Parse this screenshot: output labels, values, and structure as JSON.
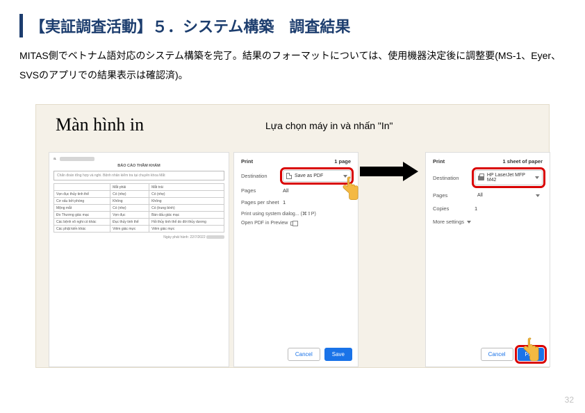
{
  "page_number": "32",
  "title": "【実証調査活動】５．システム構築　調査結果",
  "body": "MITAS側でベトナム語対応のシステム構築を完了。結果のフォーマットについては、使用機器決定後に調整要(MS-1、Eyer、SVSのアプリでの結果表示は確認済)。",
  "slide": {
    "heading": "Màn hình in",
    "sub": "Lựa chọn máy in và nhấn \"In\"",
    "doc": {
      "title": "BÁO CÁO THĂM KHÁM",
      "name_prefix": "a.",
      "box": "Chẩn đoán tổng hợp và nghi. Bệnh nhân kiểm tra tại chuyên khoa Mắt",
      "cols": [
        "",
        "Mắt phải",
        "Mắt trái"
      ],
      "rows": [
        [
          "Vẹn đục thủy tinh thể",
          "Có (nhẹ)",
          "Có (nhẹ)"
        ],
        [
          "Cơ xấu bởi phòng",
          "Không",
          "Không"
        ],
        [
          "Mộng mắt",
          "Có (nhẹ)",
          "Có (trung bình)"
        ],
        [
          "Đo Thương giác mạc",
          "Vẹn đục",
          "Bán dấu giác mạc"
        ],
        [
          "Các bệnh vô nghi có khác",
          "Đục thủy tinh thể",
          "Hỏi thủy tinh thể do đời thủy dương"
        ],
        [
          "Các phật kiến khác",
          "Viêm giác mực",
          "Viêm giác mực"
        ]
      ],
      "date": "Ngày phát hành: 22/7/2022"
    },
    "left": {
      "title": "Print",
      "count": "1 page",
      "dest_label": "Destination",
      "dest_value": "Save as PDF",
      "pages_label": "Pages",
      "pages_value": "All",
      "pps_label": "Pages per sheet",
      "pps_value": "1",
      "sys_dialog": "Print using system dialog... (⌘⇧P)",
      "open_pdf": "Open PDF in Preview",
      "cancel": "Cancel",
      "save": "Save"
    },
    "right": {
      "title": "Print",
      "count": "1 sheet of paper",
      "dest_label": "Destination",
      "dest_value": "HP LaserJet MFP M42",
      "pages_label": "Pages",
      "pages_value": "All",
      "copies_label": "Copies",
      "copies_value": "1",
      "more": "More settings",
      "cancel": "Cancel",
      "print": "Print"
    }
  }
}
